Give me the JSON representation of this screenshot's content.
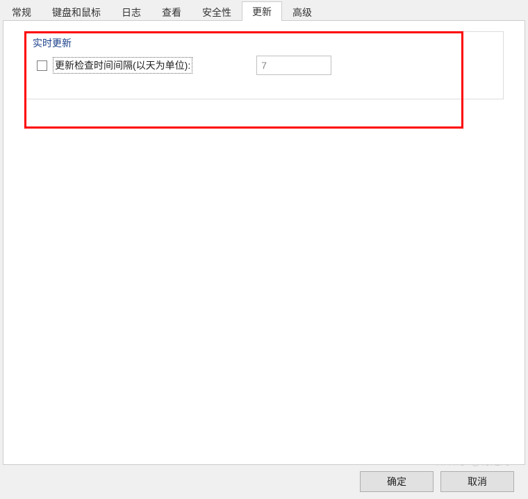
{
  "tabs": {
    "items": [
      {
        "label": "常规"
      },
      {
        "label": "键盘和鼠标"
      },
      {
        "label": "日志"
      },
      {
        "label": "查看"
      },
      {
        "label": "安全性"
      },
      {
        "label": "更新"
      },
      {
        "label": "高级"
      }
    ],
    "active_index": 5
  },
  "group": {
    "title": "实时更新",
    "checkbox_label": "更新检查时间间隔(以天为单位):",
    "checkbox_checked": false,
    "interval_value": "7"
  },
  "buttons": {
    "ok_label": "确定",
    "cancel_label": "取消"
  },
  "watermark": {
    "text": "知乎 @行走的ID"
  }
}
